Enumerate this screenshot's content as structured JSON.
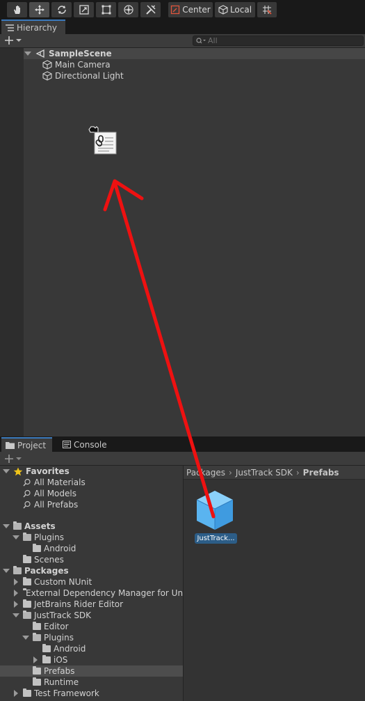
{
  "toolbar": {
    "tools": [
      "hand-tool",
      "move-tool",
      "rotate-tool",
      "scale-tool",
      "rect-tool",
      "transform-tool",
      "custom-tool"
    ],
    "pivot_mode": "Center",
    "pivot_rotation": "Local",
    "snap_icon": "grid-snap-icon"
  },
  "hierarchy": {
    "tab_label": "Hierarchy",
    "search_placeholder": "All",
    "scene": "SampleScene",
    "objects": [
      "Main Camera",
      "Directional Light"
    ]
  },
  "project": {
    "tabs": [
      "Project",
      "Console"
    ],
    "favorites": {
      "label": "Favorites",
      "items": [
        "All Materials",
        "All Models",
        "All Prefabs"
      ]
    },
    "assets": {
      "label": "Assets",
      "plugins": "Plugins",
      "android": "Android",
      "scenes": "Scenes"
    },
    "packages": {
      "label": "Packages",
      "items": [
        "Custom NUnit",
        "External Dependency Manager for Uni",
        "JetBrains Rider Editor",
        "JustTrack SDK",
        "Editor",
        "Plugins",
        "Android",
        "iOS",
        "Prefabs",
        "Runtime",
        "Test Framework"
      ]
    },
    "breadcrumb": [
      "Packages",
      "JustTrack SDK",
      "Prefabs"
    ],
    "grid_item": "JustTrack..."
  },
  "colors": {
    "accent": "#3a79bb",
    "selection": "#2c5d87",
    "arrow": "#ee1111",
    "prefab": "#5ab4f0"
  }
}
